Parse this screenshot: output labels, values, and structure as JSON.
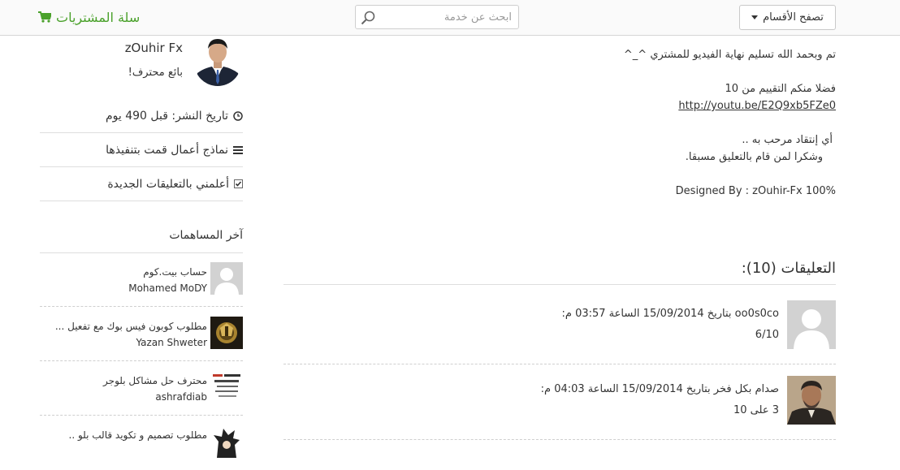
{
  "header": {
    "cart_label": "سلة المشتريات",
    "search_placeholder": "ابحث عن خدمة",
    "browse_label": "تصفح الأقسام",
    "accent_color": "#4aa12b"
  },
  "seller": {
    "name": "zOuhir Fx",
    "title": "بائع محترف!"
  },
  "sidebar": {
    "published": "تاريخ النشر: قبل 490 يوم",
    "portfolio": "نماذج أعمال قمت بتنفيذها",
    "notify": "أعلمني بالتعليقات الجديدة",
    "latest_title": "آخر المساهمات",
    "contributions": [
      {
        "title": "حساب بيت.كوم",
        "user": "Mohamed MoDY"
      },
      {
        "title": "مطلوب كوبون فيس بوك مع تفعيل ...",
        "user": "Yazan Shweter"
      },
      {
        "title": "محترف حل مشاكل بلوجر",
        "user": "ashrafdiab"
      },
      {
        "title": "مطلوب تصميم و تكويد قالب بلو ..",
        "user": ""
      }
    ]
  },
  "description": {
    "line1": "تم وبحمد الله تسليم نهاية الفيديو للمشتري ^_^",
    "line2": "فضلا منكم التقييم من 10",
    "link": "http://youtu.be/E2Q9xb5FZe0",
    "line3": "أي إنتقاد مرحب به ..",
    "line4": "وشكرا لمن قام بالتعليق مسبقا.",
    "line5": "Designed By : zOuhir-Fx 100%"
  },
  "comments": {
    "heading": "التعليقات (10):",
    "items": [
      {
        "meta": "oo0s0co بتاريخ 15/09/2014 الساعة 03:57 م:",
        "body": "6/10"
      },
      {
        "meta": "صدام بكل فخر بتاريخ 15/09/2014 الساعة 04:03 م:",
        "body": "3 على 10"
      }
    ]
  }
}
